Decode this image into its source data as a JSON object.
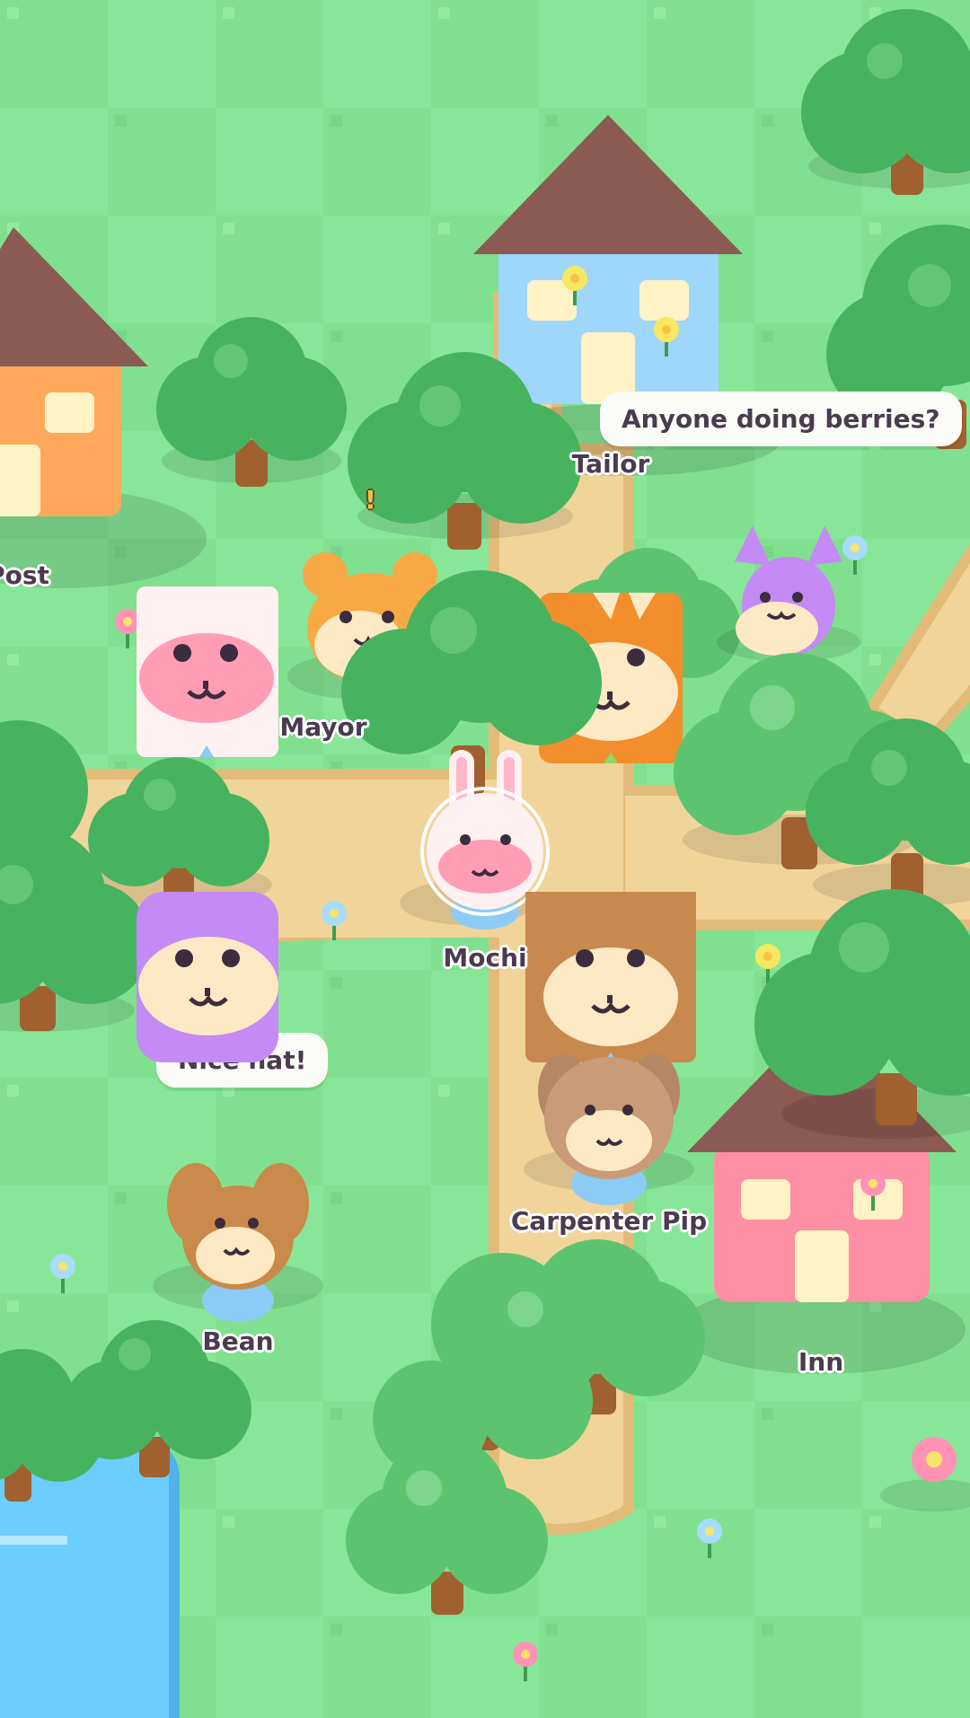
{
  "colors": {
    "grass_light": "#87e697",
    "grass_dark": "#80e08f",
    "path": "#f1d49a",
    "path_edge": "#e3bb78",
    "tree_dark": "#47b35f",
    "tree_light": "#62c673",
    "trunk": "#a0602f",
    "roof": "#8b5a52",
    "water": "#6ccdff",
    "text": "#4a3b4f"
  },
  "buildings": [
    {
      "id": "post",
      "label": "Post",
      "wall": "#ffa85c"
    },
    {
      "id": "tailor",
      "label": "Tailor",
      "wall": "#9fd6fb"
    },
    {
      "id": "inn",
      "label": "Inn",
      "wall": "#ff8fa3"
    }
  ],
  "characters": [
    {
      "id": "mayor",
      "label": "Mayor",
      "species": "cat",
      "fur": "#f6a945"
    },
    {
      "id": "mochi",
      "label": "Mochi",
      "species": "bunny",
      "fur": "#fff1f3",
      "is_player": true
    },
    {
      "id": "carpenter",
      "label": "Carpenter Pip",
      "species": "dog",
      "fur": "#c48f5e"
    },
    {
      "id": "bean",
      "label": "Bean",
      "species": "dog",
      "fur": "#c98a4b"
    },
    {
      "id": "cat-purple",
      "label": "",
      "species": "cat",
      "fur": "#c48af5"
    },
    {
      "id": "fox",
      "label": "",
      "species": "fox",
      "fur": "#f28e2b"
    },
    {
      "id": "bunny-pink",
      "label": "",
      "species": "bunny",
      "fur": "#fff0f2"
    },
    {
      "id": "hamster-purple",
      "label": "",
      "species": "hamster",
      "fur": "#c48af5"
    },
    {
      "id": "bear-brown",
      "label": "",
      "species": "bear",
      "fur": "#c8894e"
    }
  ],
  "speech_bubbles": [
    {
      "id": "berries",
      "text": "Anyone doing berries?"
    },
    {
      "id": "hat",
      "text": "Nice hat!"
    }
  ],
  "alert_mark": "!"
}
